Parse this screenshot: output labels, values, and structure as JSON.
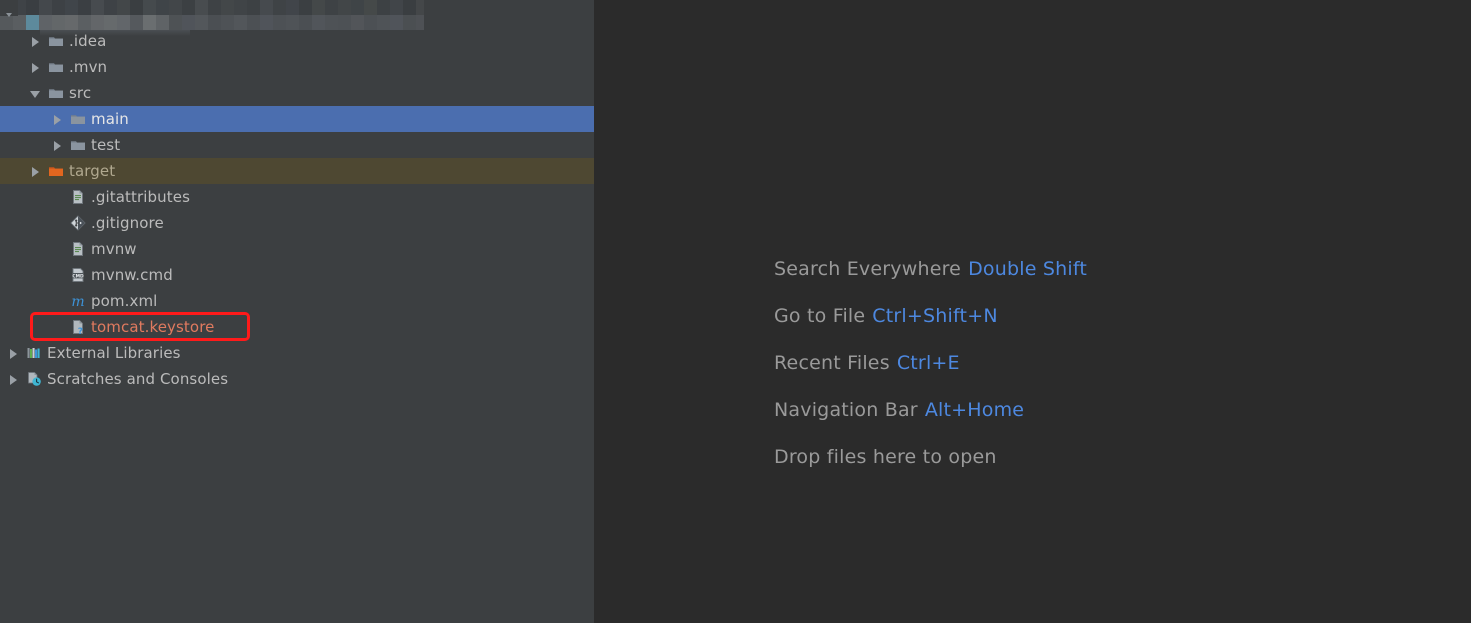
{
  "window": {
    "sidebar_bg": "#3c3f41",
    "editor_bg": "#2b2b2b",
    "selection_color": "#4b6eaf",
    "marked_color": "#4e4832",
    "highlight_color": "#ff1a1a",
    "shortcut_color": "#4d88e0"
  },
  "project_tree": {
    "redacted_title_row": "redacted",
    "items": [
      {
        "label": ".idea",
        "icon": "folder-icon",
        "arrow": "right",
        "indent": 1,
        "state": "normal"
      },
      {
        "label": ".mvn",
        "icon": "folder-icon",
        "arrow": "right",
        "indent": 1,
        "state": "normal"
      },
      {
        "label": "src",
        "icon": "folder-icon",
        "arrow": "down",
        "indent": 1,
        "state": "normal"
      },
      {
        "label": "main",
        "icon": "folder-icon",
        "arrow": "right",
        "indent": 2,
        "state": "selected"
      },
      {
        "label": "test",
        "icon": "folder-icon",
        "arrow": "right",
        "indent": 2,
        "state": "normal"
      },
      {
        "label": "target",
        "icon": "folder-orange-icon",
        "arrow": "right",
        "indent": 1,
        "state": "marked"
      },
      {
        "label": ".gitattributes",
        "icon": "text-file-icon",
        "arrow": "none",
        "indent": 2,
        "state": "normal"
      },
      {
        "label": ".gitignore",
        "icon": "git-icon",
        "arrow": "none",
        "indent": 2,
        "state": "normal"
      },
      {
        "label": "mvnw",
        "icon": "text-file-icon",
        "arrow": "none",
        "indent": 2,
        "state": "normal"
      },
      {
        "label": "mvnw.cmd",
        "icon": "cmd-file-icon",
        "arrow": "none",
        "indent": 2,
        "state": "normal"
      },
      {
        "label": "pom.xml",
        "icon": "maven-icon",
        "arrow": "none",
        "indent": 2,
        "state": "normal"
      },
      {
        "label": "tomcat.keystore",
        "icon": "unknown-file-icon",
        "arrow": "none",
        "indent": 2,
        "state": "highlighted"
      },
      {
        "label": "External Libraries",
        "icon": "libraries-icon",
        "arrow": "right",
        "indent": 0,
        "state": "normal"
      },
      {
        "label": "Scratches and Consoles",
        "icon": "scratches-icon",
        "arrow": "right",
        "indent": 0,
        "state": "normal"
      }
    ]
  },
  "editor_tips": [
    {
      "action": "Search Everywhere",
      "shortcut": "Double Shift"
    },
    {
      "action": "Go to File",
      "shortcut": "Ctrl+Shift+N"
    },
    {
      "action": "Recent Files",
      "shortcut": "Ctrl+E"
    },
    {
      "action": "Navigation Bar",
      "shortcut": "Alt+Home"
    },
    {
      "action": "Drop files here to open",
      "shortcut": ""
    }
  ]
}
